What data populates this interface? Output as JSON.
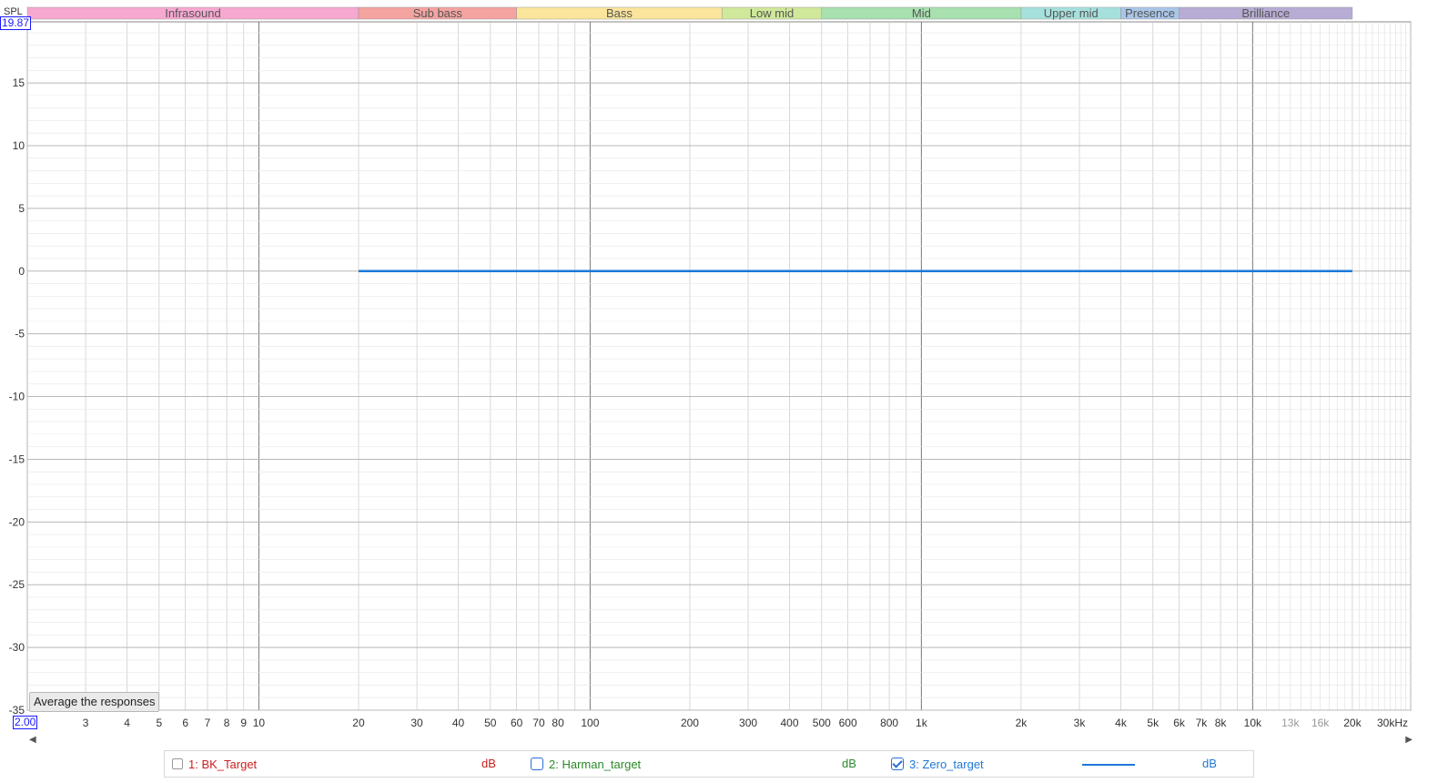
{
  "chart_data": {
    "type": "line",
    "xscale": "log",
    "xlim": [
      2,
      30000
    ],
    "ylim": [
      -35,
      19.87
    ],
    "y_axis_label": "SPL",
    "y_top_box": "19.87",
    "x_left_box": "2.00",
    "yticks": [
      15,
      10,
      5,
      0,
      -5,
      -10,
      -15,
      -20,
      -25,
      -30,
      -35
    ],
    "ytick_labels": [
      "15",
      "10",
      "5",
      "0",
      "-5",
      "-10",
      "-15",
      "-20",
      "-25",
      "-30",
      "-35"
    ],
    "xticks": [
      {
        "value": 3,
        "label": "3"
      },
      {
        "value": 4,
        "label": "4"
      },
      {
        "value": 5,
        "label": "5"
      },
      {
        "value": 6,
        "label": "6"
      },
      {
        "value": 7,
        "label": "7"
      },
      {
        "value": 8,
        "label": "8"
      },
      {
        "value": 9,
        "label": "9"
      },
      {
        "value": 10,
        "label": "10"
      },
      {
        "value": 20,
        "label": "20"
      },
      {
        "value": 30,
        "label": "30"
      },
      {
        "value": 40,
        "label": "40"
      },
      {
        "value": 50,
        "label": "50"
      },
      {
        "value": 60,
        "label": "60"
      },
      {
        "value": 70,
        "label": "70"
      },
      {
        "value": 80,
        "label": "80"
      },
      {
        "value": 100,
        "label": "100"
      },
      {
        "value": 200,
        "label": "200"
      },
      {
        "value": 300,
        "label": "300"
      },
      {
        "value": 400,
        "label": "400"
      },
      {
        "value": 500,
        "label": "500"
      },
      {
        "value": 600,
        "label": "600"
      },
      {
        "value": 800,
        "label": "800"
      },
      {
        "value": 1000,
        "label": "1k"
      },
      {
        "value": 2000,
        "label": "2k"
      },
      {
        "value": 3000,
        "label": "3k"
      },
      {
        "value": 4000,
        "label": "4k"
      },
      {
        "value": 5000,
        "label": "5k"
      },
      {
        "value": 6000,
        "label": "6k"
      },
      {
        "value": 7000,
        "label": "7k"
      },
      {
        "value": 8000,
        "label": "8k"
      },
      {
        "value": 10000,
        "label": "10k"
      },
      {
        "value": 13000,
        "label": "13k",
        "faint": true
      },
      {
        "value": 16000,
        "label": "16k",
        "faint": true
      },
      {
        "value": 20000,
        "label": "20k"
      },
      {
        "value": 30000,
        "label": "30kHz"
      }
    ],
    "bands": [
      {
        "name": "Infrasound",
        "from": 2,
        "to": 20,
        "color": "#f7a8d0"
      },
      {
        "name": "Sub bass",
        "from": 20,
        "to": 60,
        "color": "#f4a3a0"
      },
      {
        "name": "Bass",
        "from": 60,
        "to": 250,
        "color": "#fbe49b"
      },
      {
        "name": "Low mid",
        "from": 250,
        "to": 500,
        "color": "#cfe89a"
      },
      {
        "name": "Mid",
        "from": 500,
        "to": 2000,
        "color": "#a8e0b0"
      },
      {
        "name": "Upper mid",
        "from": 2000,
        "to": 4000,
        "color": "#a6e0dc"
      },
      {
        "name": "Presence",
        "from": 4000,
        "to": 6000,
        "color": "#a9c6e8"
      },
      {
        "name": "Brilliance",
        "from": 6000,
        "to": 20000,
        "color": "#b7acd4"
      }
    ],
    "series": [
      {
        "label": "3: Zero_target",
        "x": [
          20,
          20000
        ],
        "y": [
          0,
          0
        ],
        "color": "#1e78d8"
      }
    ],
    "grid": true
  },
  "controls": {
    "average_button": "Average the responses"
  },
  "legend": [
    {
      "label": "1: BK_Target",
      "unit": "dB",
      "color": "#cc2020",
      "checked": false
    },
    {
      "label": "2: Harman_target",
      "unit": "dB",
      "color": "#2a8a2a",
      "checked": false
    },
    {
      "label": "3: Zero_target",
      "unit": "dB",
      "color": "#1e78d8",
      "checked": true
    }
  ]
}
